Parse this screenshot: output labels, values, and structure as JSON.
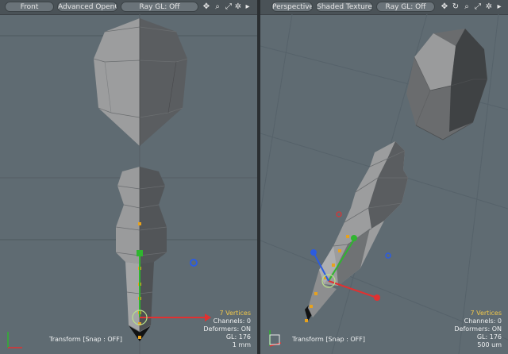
{
  "left_viewport": {
    "view_label": "Front",
    "shading_label": "Advanced OpenGL",
    "raygl_label": "Ray GL: Off",
    "info": {
      "vertices": "7 Vertices",
      "channels": "Channels: 0",
      "deformers": "Deformers: ON",
      "gl": "GL: 176",
      "scale": "1 mm"
    },
    "status": "Transform [Snap : OFF]"
  },
  "right_viewport": {
    "view_label": "Perspective",
    "shading_label": "Shaded Texture",
    "raygl_label": "Ray GL: Off",
    "info": {
      "vertices": "7 Vertices",
      "channels": "Channels: 0",
      "deformers": "Deformers: ON",
      "gl": "GL: 176",
      "scale": "500 um"
    },
    "status": "Transform [Snap : OFF]"
  },
  "icons": {
    "pan": "move-icon",
    "zoom": "magnifier-icon",
    "rotate": "rotate-icon",
    "fit": "expand-icon",
    "options": "gear-icon",
    "menu": "arrow-right-icon"
  },
  "colors": {
    "viewport_bg": "#5f6b72",
    "toolbar_bg": "#4a5257",
    "highlight": "#f1c84b",
    "axis_x": "#e03131",
    "axis_y": "#2fb52f",
    "axis_z": "#2c5ce0"
  }
}
